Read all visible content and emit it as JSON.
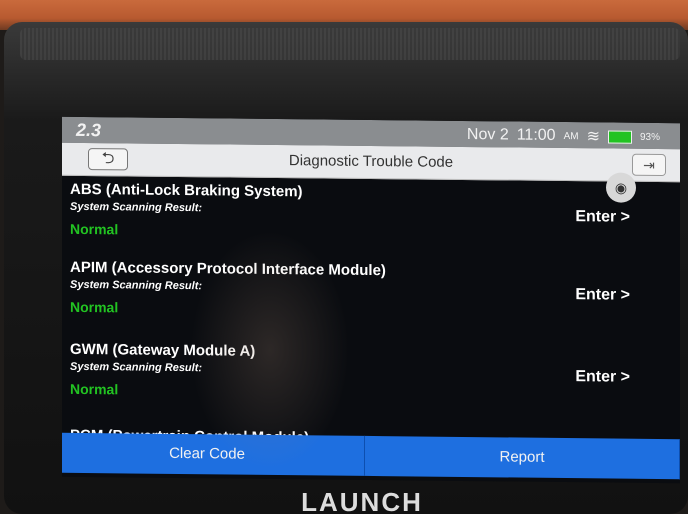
{
  "status_bar": {
    "left_text": "2.3",
    "date": "Nov 2",
    "time": "11:00",
    "am_pm": "AM",
    "battery_percent": "93%"
  },
  "header": {
    "title": "Diagnostic Trouble Code"
  },
  "systems": [
    {
      "name": "ABS (Anti-Lock Braking System)",
      "result_label": "System Scanning Result:",
      "status": "Normal",
      "action": "Enter >"
    },
    {
      "name": "APIM (Accessory Protocol Interface Module)",
      "result_label": "System Scanning Result:",
      "status": "Normal",
      "action": "Enter >"
    },
    {
      "name": "GWM (Gateway Module A)",
      "result_label": "System Scanning Result:",
      "status": "Normal",
      "action": "Enter >"
    }
  ],
  "partial_row": "PCM (Powertrain Control Module)",
  "buttons": {
    "clear": "Clear Code",
    "report": "Report"
  },
  "device_brand": "LAUNCH"
}
